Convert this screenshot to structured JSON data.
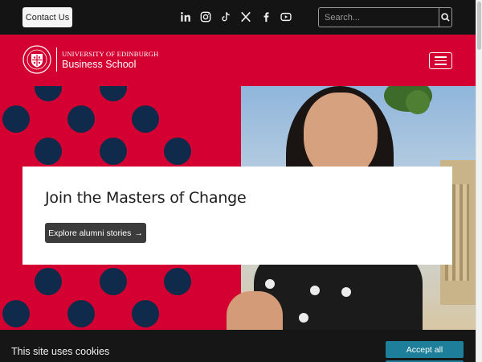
{
  "topbar": {
    "contact_label": "Contact Us",
    "socials": [
      "linkedin-icon",
      "instagram-icon",
      "tiktok-icon",
      "x-icon",
      "facebook-icon",
      "youtube-icon"
    ],
    "search": {
      "placeholder": "Search...",
      "value": ""
    }
  },
  "header": {
    "logo_university": "UNIVERSITY OF EDINBURGH",
    "logo_school": "Business School"
  },
  "hero": {
    "title": "Join the Masters of Change",
    "button_label": "Explore alumni stories",
    "button_arrow": "→"
  },
  "cookie": {
    "text": "This site uses cookies",
    "accept_label": "Accept all"
  },
  "colors": {
    "brand_red": "#d50032",
    "navy_dot": "#0f2a4a",
    "topbar": "#141414",
    "accept_teal": "#1d7f99"
  }
}
